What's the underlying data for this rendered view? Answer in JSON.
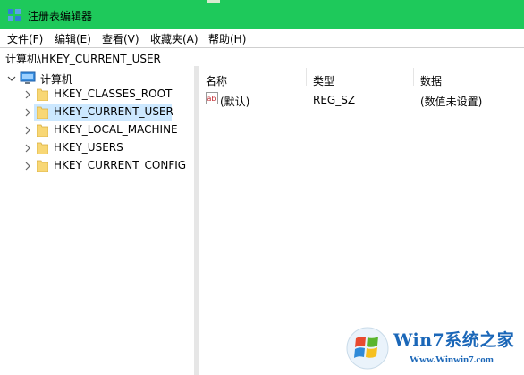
{
  "window": {
    "title": "注册表编辑器"
  },
  "menu": [
    {
      "label": "文件(F)"
    },
    {
      "label": "编辑(E)"
    },
    {
      "label": "查看(V)"
    },
    {
      "label": "收藏夹(A)"
    },
    {
      "label": "帮助(H)"
    }
  ],
  "address": {
    "path": "计算机\\HKEY_CURRENT_USER"
  },
  "tree": {
    "root": {
      "label": "计算机",
      "icon": "computer-icon",
      "expanded": true
    },
    "children": [
      {
        "label": "HKEY_CLASSES_ROOT",
        "selected": false
      },
      {
        "label": "HKEY_CURRENT_USER",
        "selected": true
      },
      {
        "label": "HKEY_LOCAL_MACHINE",
        "selected": false
      },
      {
        "label": "HKEY_USERS",
        "selected": false
      },
      {
        "label": "HKEY_CURRENT_CONFIG",
        "selected": false
      }
    ]
  },
  "list": {
    "columns": [
      "名称",
      "类型",
      "数据"
    ],
    "rows": [
      {
        "name": "(默认)",
        "type": "REG_SZ",
        "data": "(数值未设置)",
        "icon": "string-value-icon"
      }
    ]
  },
  "watermark": {
    "brand": "Win7系统之家",
    "url": "Www.Winwin7.com"
  },
  "colors": {
    "titlebar": "#1ec95b",
    "selection": "#cce8ff",
    "folder": "#f8d775",
    "watermark": "#1b67b8"
  }
}
